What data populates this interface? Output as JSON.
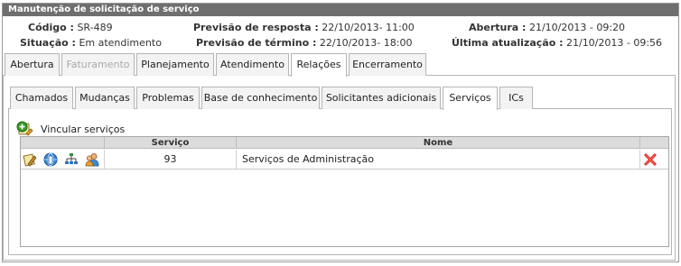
{
  "panel": {
    "title": "Manutenção de solicitação de serviço"
  },
  "info": {
    "codigo_label": "Código :",
    "codigo_value": "SR-489",
    "previsao_resposta_label": "Previsão de resposta :",
    "previsao_resposta_value": "22/10/2013- 11:00",
    "abertura_label": "Abertura :",
    "abertura_value": "21/10/2013 - 09:20",
    "situacao_label": "Situação :",
    "situacao_value": "Em atendimento",
    "previsao_termino_label": "Previsão de término :",
    "previsao_termino_value": "22/10/2013- 18:00",
    "ultima_atualizacao_label": "Última atualização :",
    "ultima_atualizacao_value": "21/10/2013 - 09:56"
  },
  "main_tabs": [
    {
      "label": "Abertura",
      "state": "normal"
    },
    {
      "label": "Faturamento",
      "state": "disabled"
    },
    {
      "label": "Planejamento",
      "state": "normal"
    },
    {
      "label": "Atendimento",
      "state": "normal"
    },
    {
      "label": "Relações",
      "state": "active"
    },
    {
      "label": "Encerramento",
      "state": "normal"
    }
  ],
  "sub_tabs": [
    {
      "label": "Chamados",
      "state": "normal"
    },
    {
      "label": "Mudanças",
      "state": "normal"
    },
    {
      "label": "Problemas",
      "state": "normal"
    },
    {
      "label": "Base de conhecimento",
      "state": "normal"
    },
    {
      "label": "Solicitantes adicionais",
      "state": "normal"
    },
    {
      "label": "Serviços",
      "state": "active"
    },
    {
      "label": "ICs",
      "state": "normal"
    }
  ],
  "actions": {
    "link_service_label": "Vincular serviços",
    "link_service_icon": "add-link-icon"
  },
  "table": {
    "columns": [
      "Serviço",
      "Nome"
    ],
    "rows": [
      {
        "servico": "93",
        "nome": "Serviços de Administração",
        "row_icons": [
          "edit-icon",
          "info-globe-icon",
          "hierarchy-icon",
          "users-icon"
        ],
        "delete_icon": "delete-icon"
      }
    ]
  },
  "colors": {
    "title_bar": "#6f6f6f",
    "tab_bg": "#f3f3f3",
    "border": "#b5b5b5",
    "header_bg": "#dcdcdc",
    "delete_red": "#d9211c"
  }
}
